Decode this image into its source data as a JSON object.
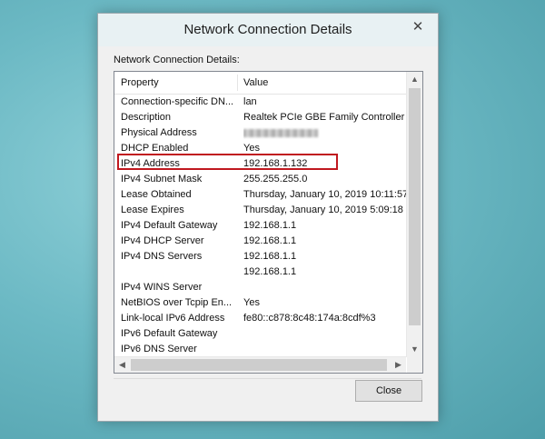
{
  "dialog": {
    "title": "Network Connection Details",
    "close_glyph": "✕",
    "group_label": "Network Connection Details:",
    "close_button_label": "Close"
  },
  "table": {
    "headers": [
      "Property",
      "Value"
    ],
    "rows": [
      {
        "property": "Connection-specific DN...",
        "value": "lan"
      },
      {
        "property": "Description",
        "value": "Realtek PCIe GBE Family Controller"
      },
      {
        "property": "Physical Address",
        "value": ""
      },
      {
        "property": "DHCP Enabled",
        "value": "Yes"
      },
      {
        "property": "IPv4 Address",
        "value": "192.168.1.132"
      },
      {
        "property": "IPv4 Subnet Mask",
        "value": "255.255.255.0"
      },
      {
        "property": "Lease Obtained",
        "value": "Thursday, January 10, 2019 10:11:57"
      },
      {
        "property": "Lease Expires",
        "value": "Thursday, January 10, 2019 5:09:18 P"
      },
      {
        "property": "IPv4 Default Gateway",
        "value": "192.168.1.1"
      },
      {
        "property": "IPv4 DHCP Server",
        "value": "192.168.1.1"
      },
      {
        "property": "IPv4 DNS Servers",
        "value": "192.168.1.1"
      },
      {
        "property": "",
        "value": "192.168.1.1"
      },
      {
        "property": "IPv4 WINS Server",
        "value": ""
      },
      {
        "property": "NetBIOS over Tcpip En...",
        "value": "Yes"
      },
      {
        "property": "Link-local IPv6 Address",
        "value": "fe80::c878:8c48:174a:8cdf%3"
      },
      {
        "property": "IPv6 Default Gateway",
        "value": ""
      },
      {
        "property": "IPv6 DNS Server",
        "value": ""
      }
    ]
  },
  "scroll_glyphs": {
    "up": "▲",
    "down": "▼",
    "left": "◀",
    "right": "▶"
  },
  "colors": {
    "highlight_border": "#c0181f",
    "background": "#6cb9c4"
  }
}
